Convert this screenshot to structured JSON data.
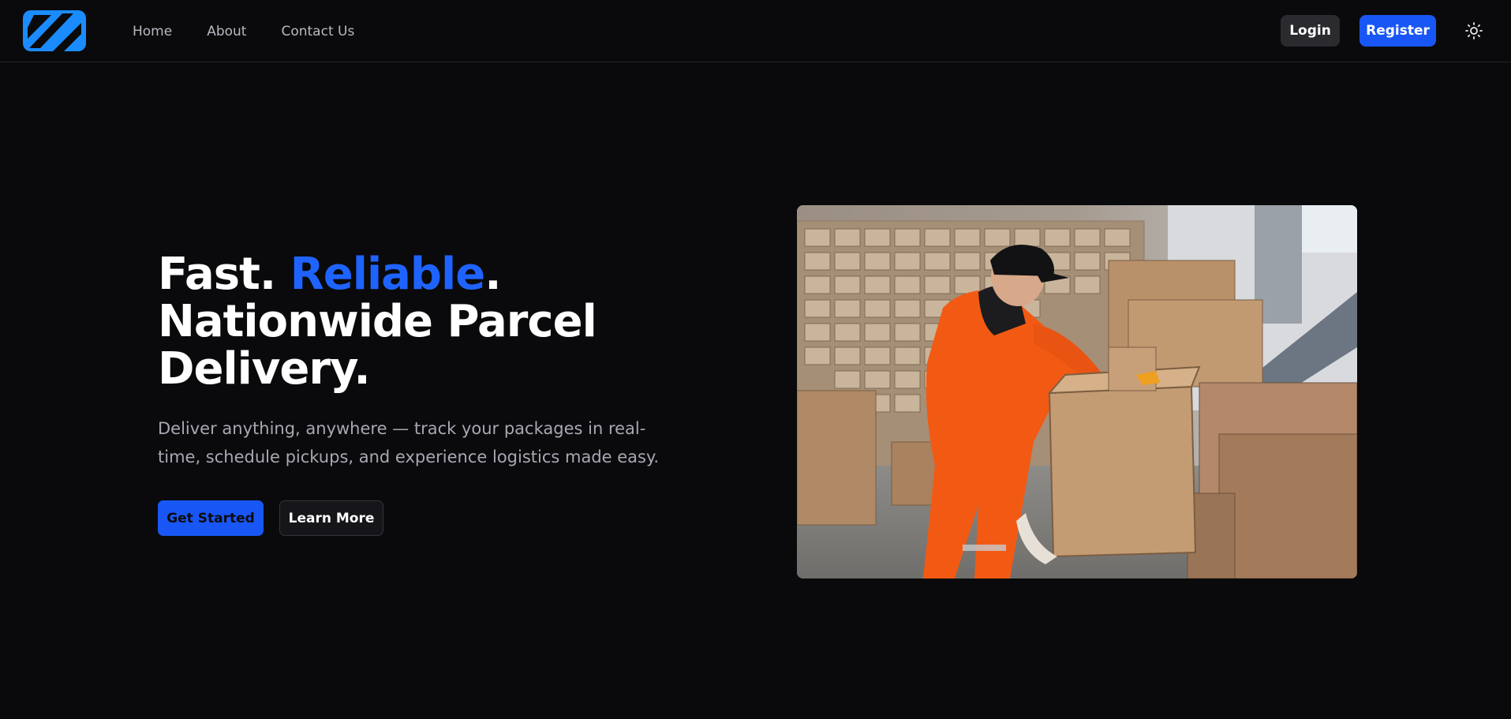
{
  "nav": {
    "links": [
      "Home",
      "About",
      "Contact Us"
    ],
    "login_label": "Login",
    "register_label": "Register",
    "theme_icon": "sun-icon"
  },
  "hero": {
    "title_part1": "Fast. ",
    "title_accent": "Reliable",
    "title_part2": ".",
    "title_line2": "Nationwide Parcel",
    "title_line3": "Delivery.",
    "subtitle": "Deliver anything, anywhere — track your packages in real-time, schedule pickups, and experience logistics made easy.",
    "primary_button": "Get Started",
    "secondary_button": "Learn More"
  },
  "colors": {
    "background": "#0a0a0c",
    "accent": "#1f63ff",
    "button_primary": "#1857f5",
    "muted_text": "#a8a8b3"
  }
}
